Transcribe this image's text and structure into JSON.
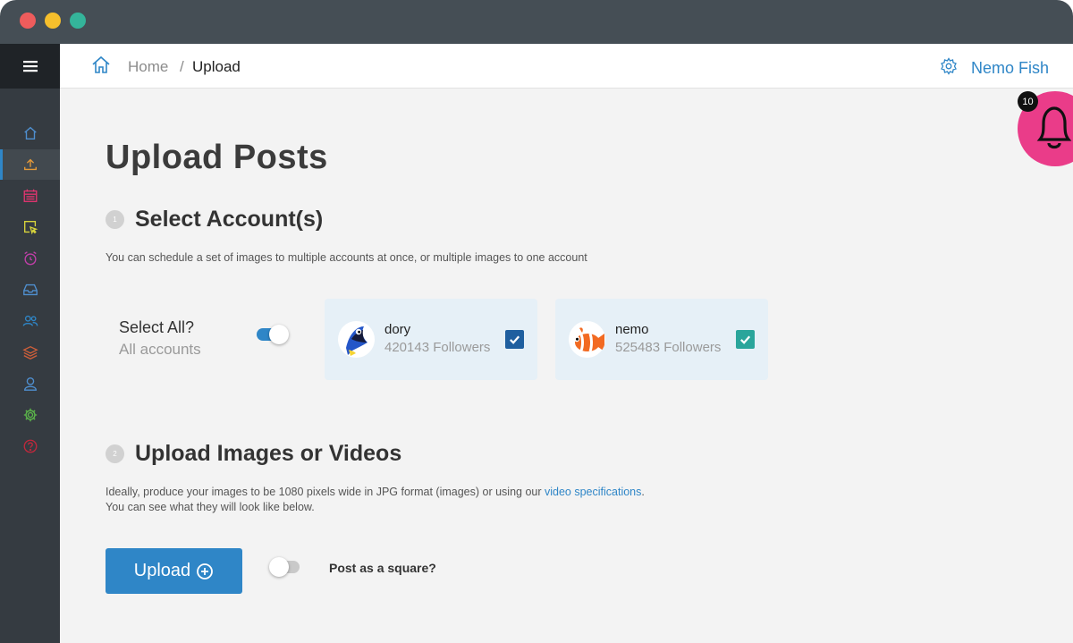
{
  "window": {
    "controls": [
      "close",
      "minimize",
      "maximize"
    ],
    "colors": {
      "close": "#ee5c5c",
      "minimize": "#f6bf2c",
      "maximize": "#34b49a"
    }
  },
  "sidebar": {
    "menu_icon": "hamburger-icon",
    "items": [
      {
        "icon": "home-icon",
        "color": "#4f8fd0",
        "active": false
      },
      {
        "icon": "upload-icon",
        "color": "#e59a39",
        "active": true
      },
      {
        "icon": "calendar-icon",
        "color": "#e0356f",
        "active": false
      },
      {
        "icon": "cursor-icon",
        "color": "#d8d43c",
        "active": false
      },
      {
        "icon": "alarm-icon",
        "color": "#c03fa8",
        "active": false
      },
      {
        "icon": "inbox-icon",
        "color": "#4f8fd0",
        "active": false
      },
      {
        "icon": "users-icon",
        "color": "#2f86c7",
        "active": false
      },
      {
        "icon": "layers-icon",
        "color": "#cf5f3a",
        "active": false
      },
      {
        "icon": "user-icon",
        "color": "#4f8fd0",
        "active": false
      },
      {
        "icon": "gear-icon",
        "color": "#5cb84a",
        "active": false
      },
      {
        "icon": "help-icon",
        "color": "#c0283c",
        "active": false
      }
    ]
  },
  "topbar": {
    "breadcrumb": {
      "home": "Home",
      "separator": "/",
      "current": "Upload"
    },
    "user_name": "Nemo Fish"
  },
  "notifications": {
    "count": "10",
    "color": "#ea3c89"
  },
  "page": {
    "title": "Upload Posts",
    "step1": {
      "number": "1",
      "title": "Select Account(s)",
      "description": "You can schedule a set of images to multiple accounts at once, or multiple images to one account"
    },
    "select_all": {
      "label": "Select All?",
      "sub": "All accounts",
      "on": true
    },
    "accounts": [
      {
        "name": "dory",
        "followers": "420143 Followers",
        "checked": true,
        "check_color": "#1f5f9f",
        "avatar": "dory-avatar"
      },
      {
        "name": "nemo",
        "followers": "525483 Followers",
        "checked": true,
        "check_color": "#2aa59b",
        "avatar": "nemo-avatar"
      }
    ],
    "step2": {
      "number": "2",
      "title": "Upload Images or Videos",
      "desc_line1_prefix": "Ideally, produce your images to be 1080 pixels wide in JPG format (images) or using our ",
      "desc_link": "video specifications",
      "desc_line1_suffix": ".",
      "desc_line2": "You can see what they will look like below."
    },
    "upload_button": "Upload",
    "post_square": {
      "label": "Post as a square?",
      "on": false
    }
  },
  "accent_color": "#2f86c7"
}
